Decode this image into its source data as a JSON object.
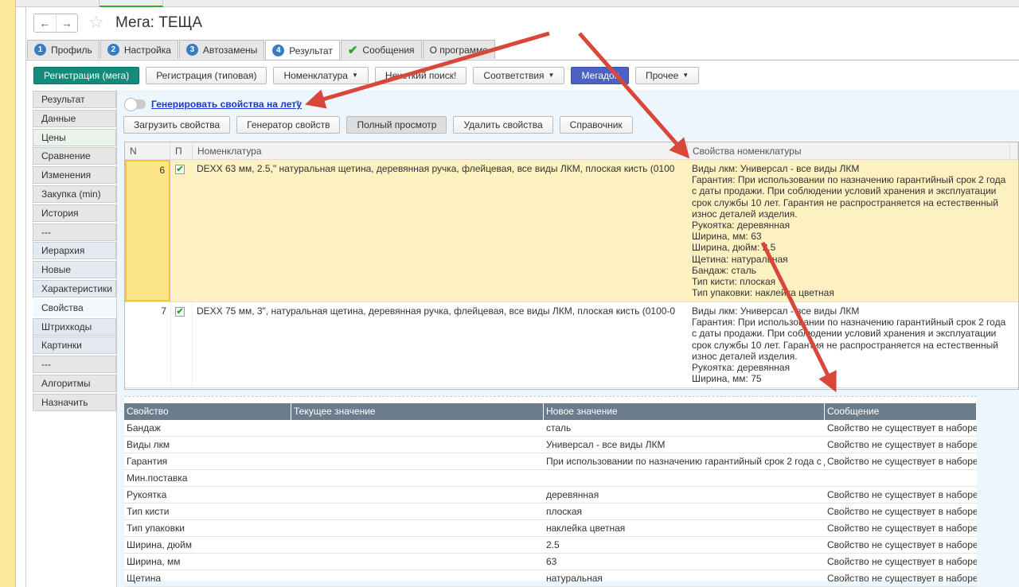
{
  "window": {
    "title": "Мега: ТЕЩА",
    "back": "←",
    "forward": "→"
  },
  "tabs": [
    {
      "num": "1",
      "label": "Профиль"
    },
    {
      "num": "2",
      "label": "Настройка"
    },
    {
      "num": "3",
      "label": "Автозамены"
    },
    {
      "num": "4",
      "label": "Результат"
    },
    {
      "num": "✔",
      "label": "Сообщения"
    },
    {
      "num": "",
      "label": "О программе"
    }
  ],
  "toolbar": {
    "reg_mega": "Регистрация (мега)",
    "reg_typical": "Регистрация (типовая)",
    "nomenclature": "Номенклатура",
    "fuzzy": "Нечеткий поиск!",
    "matches": "Соответствия",
    "megadoc": "Мегадок",
    "other": "Прочее"
  },
  "sidebar": [
    "Результат",
    "Данные",
    "Цены",
    "Сравнение",
    "Изменения",
    "Закупка (min)",
    "История",
    "---",
    "Иерархия",
    "Новые",
    "Характеристики",
    "Свойства",
    "Штрихкоды",
    "Картинки",
    "---",
    "Алгоритмы",
    "Назначить"
  ],
  "generate": {
    "label": "Генерировать свойства на лету",
    "help": "?"
  },
  "actions": {
    "load": "Загрузить свойства",
    "generator": "Генератор свойств",
    "full_view": "Полный просмотр",
    "delete": "Удалить свойства",
    "reference": "Справочник"
  },
  "grid": {
    "headers": [
      "N",
      "П",
      "Номенклатура",
      "Свойства номенклатуры"
    ],
    "rows": [
      {
        "n": "6",
        "checked": "✔",
        "name": "DEXX 63 мм, 2.5,\" натуральная щетина, деревянная ручка, флейцевая, все виды ЛКМ, плоская кисть (0100",
        "props": [
          "Виды лкм: Универсал - все виды ЛКМ",
          "Гарантия: При использовании по назначению гарантийный срок 2 года с даты продажи. При соблюдении условий хранения и эксплуатации срок службы 10 лет. Гарантия не распространяется на естественный износ деталей изделия.",
          "Рукоятка: деревянная",
          "Ширина, мм: 63",
          "Ширина, дюйм: 2.5",
          "Щетина: натуральная",
          "Бандаж: сталь",
          "Тип кисти: плоская",
          "Тип упаковки: наклейка цветная"
        ]
      },
      {
        "n": "7",
        "checked": "✔",
        "name": "DEXX 75 мм, 3\", натуральная щетина, деревянная ручка, флейцевая, все виды ЛКМ, плоская кисть (0100-0",
        "props": [
          "Виды лкм: Универсал - все виды ЛКМ",
          "Гарантия: При использовании по назначению гарантийный срок 2 года с даты продажи. При соблюдении условий хранения и эксплуатации срок службы 10 лет. Гарантия не распространяется на естественный износ деталей изделия.",
          "Рукоятка: деревянная",
          "Ширина, мм: 75"
        ]
      }
    ]
  },
  "props_table": {
    "headers": [
      "Свойство",
      "Текущее значение",
      "Новое значение",
      "Сообщение"
    ],
    "rows": [
      [
        "Бандаж",
        "",
        "сталь",
        "Свойство не существует в наборе."
      ],
      [
        "Виды лкм",
        "",
        "Универсал - все виды ЛКМ",
        "Свойство не существует в наборе."
      ],
      [
        "Гарантия",
        "",
        "При использовании по назначению гарантийный срок 2 года с д",
        "Свойство не существует в наборе."
      ],
      [
        "Мин.поставка",
        "",
        "",
        ""
      ],
      [
        "Рукоятка",
        "",
        "деревянная",
        "Свойство не существует в наборе."
      ],
      [
        "Тип кисти",
        "",
        "плоская",
        "Свойство не существует в наборе."
      ],
      [
        "Тип упаковки",
        "",
        "наклейка цветная",
        "Свойство не существует в наборе."
      ],
      [
        "Ширина, дюйм",
        "",
        "2.5",
        "Свойство не существует в наборе."
      ],
      [
        "Ширина, мм",
        "",
        "63",
        "Свойство не существует в наборе."
      ],
      [
        "Щетина",
        "",
        "натуральная",
        "Свойство не существует в наборе."
      ]
    ]
  },
  "colors": {
    "accent_green": "#138a7a",
    "megadoc_blue": "#4d63c3",
    "selection": "#fdf1c2",
    "arrow": "#d9473b"
  }
}
